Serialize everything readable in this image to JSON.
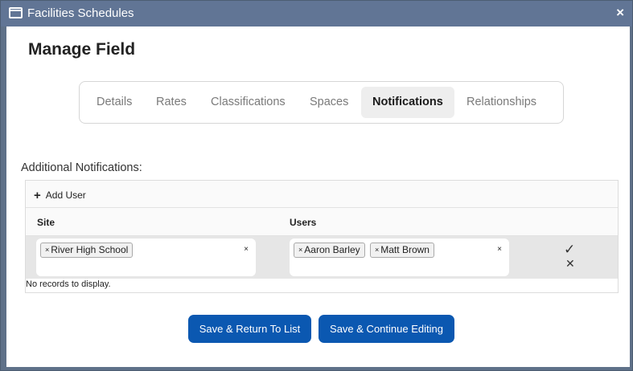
{
  "window": {
    "title": "Facilities Schedules",
    "close_label": "×"
  },
  "page": {
    "title": "Manage Field"
  },
  "tabs": [
    {
      "label": "Details",
      "active": false
    },
    {
      "label": "Rates",
      "active": false
    },
    {
      "label": "Classifications",
      "active": false
    },
    {
      "label": "Spaces",
      "active": false
    },
    {
      "label": "Notifications",
      "active": true
    },
    {
      "label": "Relationships",
      "active": false
    }
  ],
  "notifications": {
    "section_label": "Additional Notifications:",
    "add_user_label": "Add User",
    "columns": [
      "Site",
      "Users"
    ],
    "edit_row": {
      "site_values": [
        "River High School"
      ],
      "user_values": [
        "Aaron Barley",
        "Matt Brown"
      ],
      "chip_remove": "×",
      "clear": "×",
      "save_icon": "✓",
      "cancel_icon": "✕"
    },
    "empty_message": "No records to display."
  },
  "buttons": {
    "save_return": "Save & Return To List",
    "save_continue": "Save & Continue Editing"
  },
  "colors": {
    "titlebar": "#617595",
    "primary_button": "#0b58b1",
    "active_tab_bg": "#eeeeee"
  }
}
